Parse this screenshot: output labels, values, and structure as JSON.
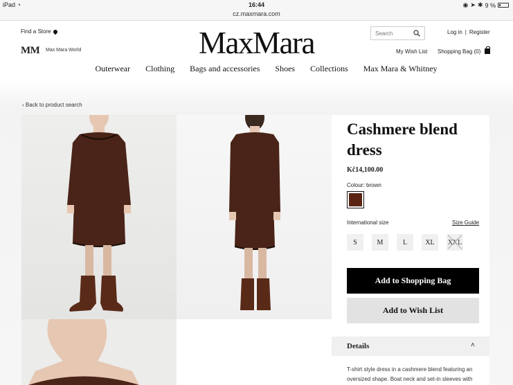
{
  "status_bar": {
    "device": "iPad",
    "time": "16:44",
    "battery": "9 %"
  },
  "browser": {
    "url": "cz.maxmara.com"
  },
  "header": {
    "find_store": "Find a Store",
    "mm_logo": "MM",
    "mm_world": "Max Mara World",
    "brand": "MaxMara",
    "search_placeholder": "Search",
    "login": "Log in",
    "separator": "|",
    "register": "Register",
    "wishlist": "My Wish List",
    "shopping_bag": "Shopping Bag (0)"
  },
  "nav": {
    "items": [
      "Outerwear",
      "Clothing",
      "Bags and accessories",
      "Shoes",
      "Collections",
      "Max Mara & Whitney"
    ]
  },
  "back_link": "Back to product search",
  "product": {
    "title": "Cashmere blend dress",
    "price": "Kč14,100.00",
    "colour_label": "Colour:",
    "colour_value": "brown",
    "swatch_color": "#5a2312",
    "size_label": "International size",
    "size_guide": "Size Guide",
    "sizes": [
      {
        "label": "S",
        "available": true
      },
      {
        "label": "M",
        "available": true
      },
      {
        "label": "L",
        "available": true
      },
      {
        "label": "XL",
        "available": true
      },
      {
        "label": "XXL",
        "available": false
      }
    ],
    "add_to_bag": "Add to Shopping Bag",
    "add_to_wishlist": "Add to Wish List",
    "details_title": "Details",
    "details_text": "T-shirt style dress in a cashmere blend featuring an oversized shape. Boat neck and set-in sleeves with"
  },
  "colors": {
    "dress": "#4a2418",
    "boots": "#5a2a18",
    "skin": "#e6c7b2"
  }
}
